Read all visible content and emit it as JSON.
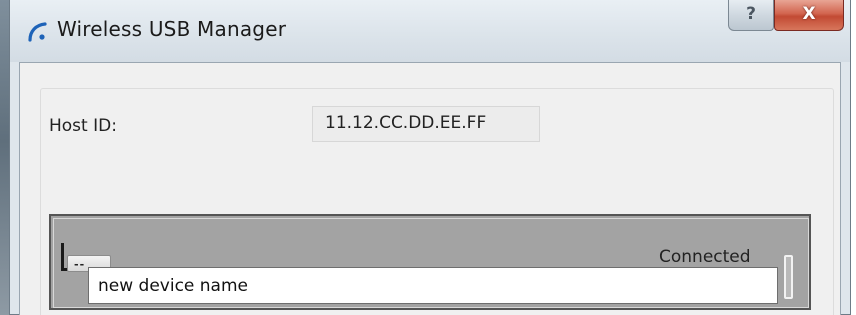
{
  "window": {
    "title": "Wireless USB Manager",
    "help_label": "?",
    "close_label": "X"
  },
  "host": {
    "label": "Host ID:",
    "value": "11.12.CC.DD.EE.FF"
  },
  "device": {
    "button_label": "--",
    "status": "Connected",
    "name_value": "new device name"
  },
  "colors": {
    "title_bar": "#dbe3ea",
    "client_background": "#f0f0f0",
    "device_panel": "#a3a3a3",
    "close_button": "#c24a33",
    "app_icon": "#1e63b8"
  }
}
